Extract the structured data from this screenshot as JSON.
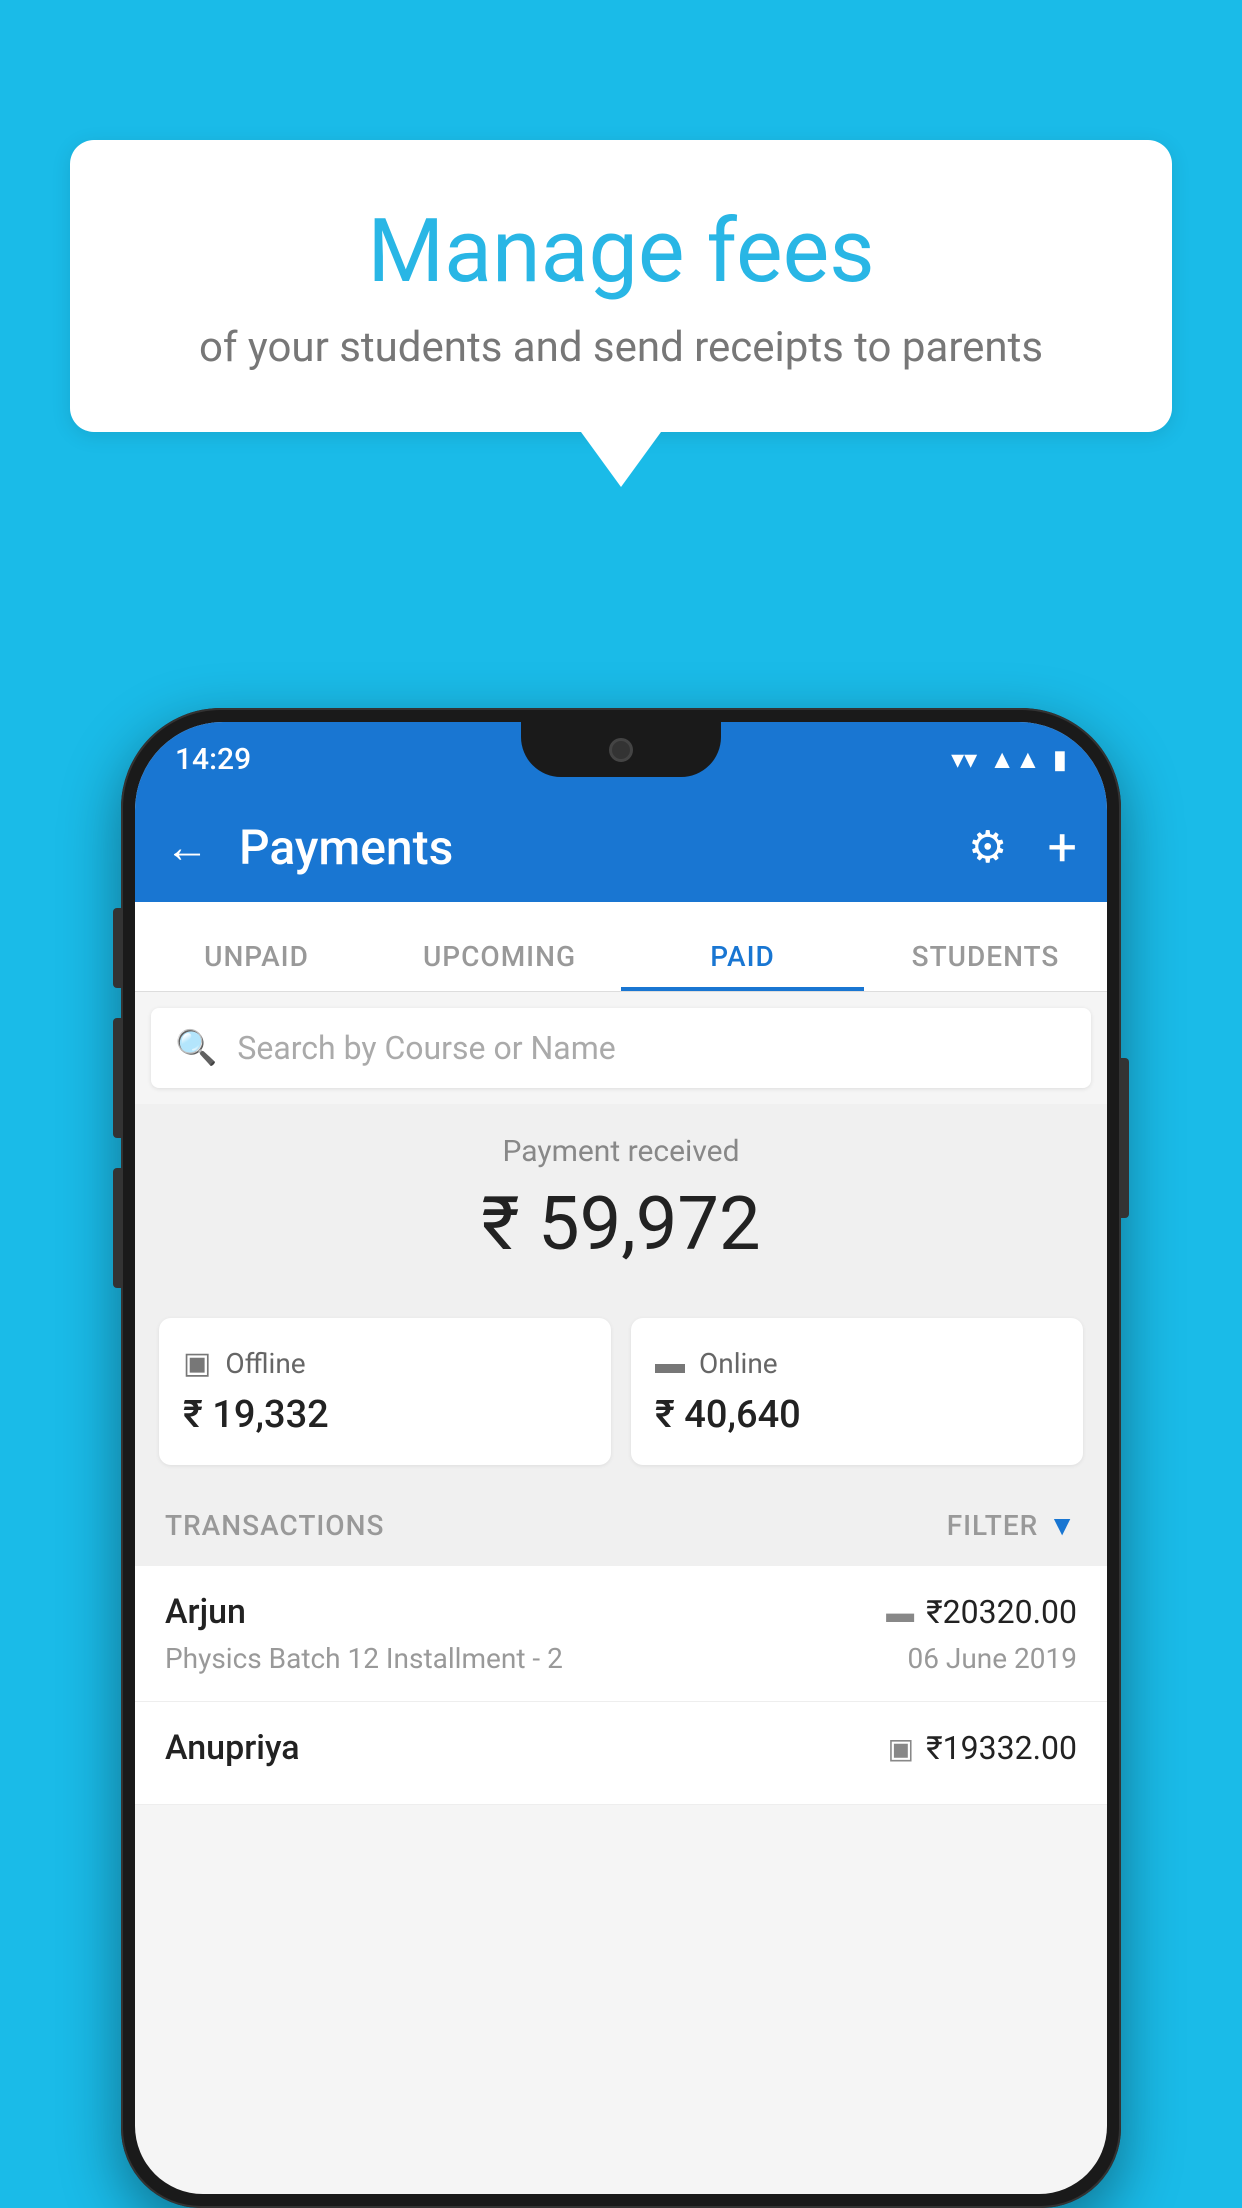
{
  "background_color": "#1ABBE8",
  "speech_bubble": {
    "title": "Manage fees",
    "subtitle": "of your students and send receipts to parents"
  },
  "status_bar": {
    "time": "14:29",
    "wifi": "▼",
    "signal": "▲",
    "battery": "▮"
  },
  "app_bar": {
    "title": "Payments",
    "back_label": "←",
    "gear_label": "⚙",
    "plus_label": "+"
  },
  "tabs": [
    {
      "label": "UNPAID",
      "active": false
    },
    {
      "label": "UPCOMING",
      "active": false
    },
    {
      "label": "PAID",
      "active": true
    },
    {
      "label": "STUDENTS",
      "active": false
    }
  ],
  "search": {
    "placeholder": "Search by Course or Name"
  },
  "payment_summary": {
    "label": "Payment received",
    "amount": "₹ 59,972"
  },
  "payment_methods": [
    {
      "type": "Offline",
      "amount": "₹ 19,332",
      "icon": "receipt"
    },
    {
      "type": "Online",
      "amount": "₹ 40,640",
      "icon": "card"
    }
  ],
  "transactions_section": {
    "label": "TRANSACTIONS",
    "filter_label": "FILTER"
  },
  "transactions": [
    {
      "name": "Arjun",
      "course": "Physics Batch 12 Installment - 2",
      "amount": "₹20320.00",
      "date": "06 June 2019",
      "payment_icon": "card"
    },
    {
      "name": "Anupriya",
      "course": "",
      "amount": "₹19332.00",
      "date": "",
      "payment_icon": "receipt"
    }
  ]
}
